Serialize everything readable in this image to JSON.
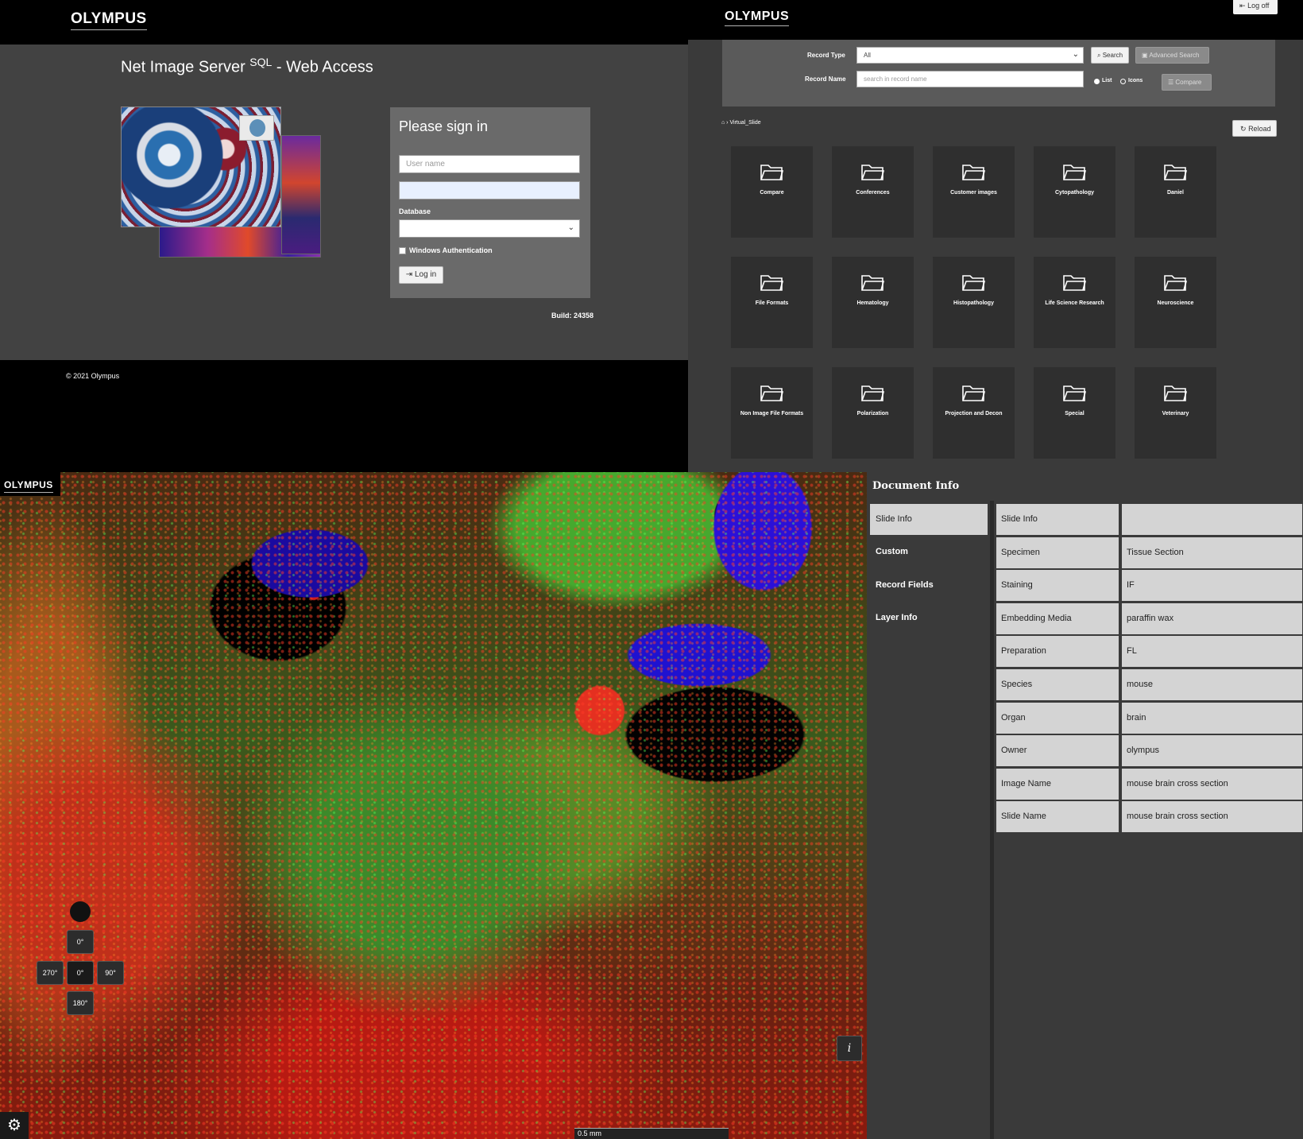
{
  "login": {
    "logo": "OLYMPUS",
    "title_main": "Net Image Server ",
    "title_sup": "SQL",
    "title_tail": " - Web Access",
    "form_title": "Please sign in",
    "username_placeholder": "User name",
    "database_label": "Database",
    "windows_auth_label": "Windows Authentication",
    "login_button": "Log in",
    "build": "Build: 24358",
    "copyright": "© 2021 Olympus"
  },
  "browser": {
    "logo": "OLYMPUS",
    "logoff_label": "Log off",
    "record_type_label": "Record Type",
    "record_type_value": "All",
    "record_name_label": "Record Name",
    "record_name_placeholder": "search in record name",
    "search_button": "Search",
    "advanced_search_button": "Advanced Search",
    "compare_button": "Compare",
    "view_list_label": "List",
    "view_icons_label": "Icons",
    "breadcrumb": "Virtual_Slide",
    "reload_button": "Reload",
    "folders": [
      "Compare",
      "Conferences",
      "Customer images",
      "Cytopathology",
      "Daniel",
      "File Formats",
      "Hematology",
      "Histopathology",
      "Life Science Research",
      "Neuroscience",
      "Non Image File Formats",
      "Polarization",
      "Projection and Decon",
      "Special",
      "Veterinary"
    ]
  },
  "viewer": {
    "logo": "OLYMPUS",
    "rotation": {
      "top": "0°",
      "center": "0°",
      "left": "270°",
      "right": "90°",
      "bottom": "180°"
    },
    "info_button": "i",
    "scale": "0.5 mm"
  },
  "docinfo": {
    "title": "Document Info",
    "tabs": [
      "Slide Info",
      "Custom",
      "Record Fields",
      "Layer Info"
    ],
    "active_tab": "Slide Info",
    "rows": [
      {
        "key": "Slide Info",
        "value": ""
      },
      {
        "key": "Specimen",
        "value": "Tissue Section"
      },
      {
        "key": "Staining",
        "value": "IF"
      },
      {
        "key": "Embedding Media",
        "value": "paraffin wax"
      },
      {
        "key": "Preparation",
        "value": "FL"
      },
      {
        "key": "Species",
        "value": "mouse"
      },
      {
        "key": "Organ",
        "value": "brain"
      },
      {
        "key": "Owner",
        "value": "olympus"
      },
      {
        "key": "Image Name",
        "value": "mouse brain cross section"
      },
      {
        "key": "Slide Name",
        "value": "mouse brain cross section"
      }
    ]
  }
}
